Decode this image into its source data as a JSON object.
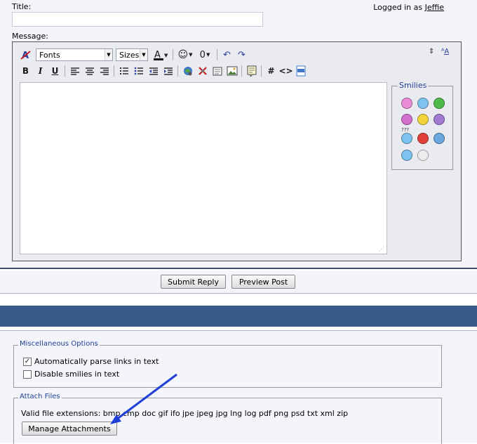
{
  "form": {
    "title_label": "Title:",
    "title_value": "",
    "message_label": "Message:",
    "logged_in_prefix": "Logged in as",
    "username": "Jeffie"
  },
  "toolbar": {
    "font_combo": "Fonts",
    "size_combo": "Sizes",
    "bold": "B",
    "italic": "I",
    "underline": "U",
    "hash": "#",
    "code": "<>"
  },
  "smilies": {
    "legend": "Smilies",
    "question_marks": "???"
  },
  "actions": {
    "submit": "Submit Reply",
    "preview": "Preview Post"
  },
  "misc": {
    "legend": "Miscellaneous Options",
    "parse_links_label": "Automatically parse links in text",
    "parse_links_checked": true,
    "disable_smilies_label": "Disable smilies in text",
    "disable_smilies_checked": false
  },
  "attach": {
    "legend": "Attach Files",
    "extensions_text": "Valid file extensions: bmp cmp doc gif ifo jpe jpeg jpg lng log pdf png psd txt xml zip",
    "manage_button": "Manage Attachments"
  },
  "colors": {
    "header_bar": "#3a5a8c",
    "legend_text": "#22409a",
    "annotation_arrow": "#1f3fd6"
  }
}
